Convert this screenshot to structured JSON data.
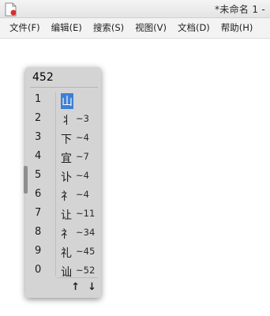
{
  "window": {
    "title": "*未命名 1 -"
  },
  "menubar": {
    "items": [
      "文件(F)",
      "编辑(E)",
      "搜索(S)",
      "视图(V)",
      "文档(D)",
      "帮助(H)"
    ]
  },
  "ime": {
    "preedit": "452",
    "candidates": [
      {
        "num": "1",
        "char": "山",
        "code": ""
      },
      {
        "num": "2",
        "char": "丬",
        "code": "~3"
      },
      {
        "num": "3",
        "char": "下",
        "code": "~4"
      },
      {
        "num": "4",
        "char": "宜",
        "code": "~7"
      },
      {
        "num": "5",
        "char": "讣",
        "code": "~4"
      },
      {
        "num": "6",
        "char": "礻",
        "code": "~4"
      },
      {
        "num": "7",
        "char": "让",
        "code": "~11"
      },
      {
        "num": "8",
        "char": "礻",
        "code": "~34"
      },
      {
        "num": "9",
        "char": "礼",
        "code": "~45"
      },
      {
        "num": "0",
        "char": "讪",
        "code": "~52"
      }
    ],
    "selected_index": 0,
    "pager": {
      "prev": "↑",
      "next": "↓"
    }
  },
  "icons": [
    "app-document-icon",
    "page-up-icon",
    "page-down-icon"
  ],
  "colors": {
    "selection": "#3d7fd6",
    "panel": "#d4d4d4"
  }
}
